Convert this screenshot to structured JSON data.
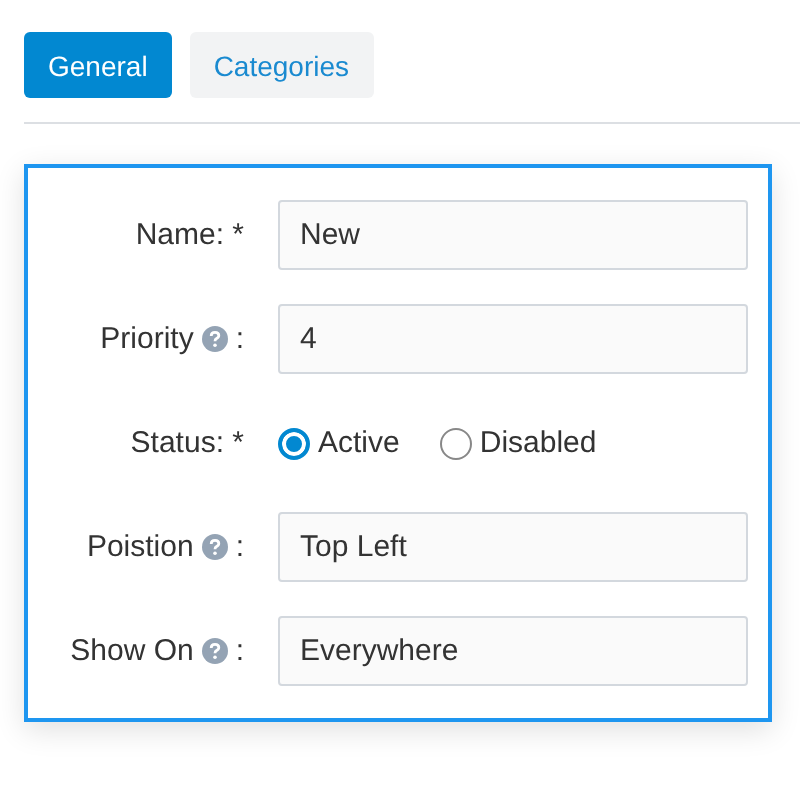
{
  "tabs": [
    {
      "label": "General",
      "selected": true
    },
    {
      "label": "Categories",
      "selected": false
    }
  ],
  "form": {
    "fields": [
      {
        "kind": "text",
        "label": "Name: *",
        "help": false,
        "value": "New"
      },
      {
        "kind": "text",
        "label": "Priority",
        "help": true,
        "colon": ":",
        "value": "4"
      },
      {
        "kind": "radio",
        "label": "Status: *",
        "help": false,
        "options": [
          {
            "label": "Active",
            "selected": true
          },
          {
            "label": "Disabled",
            "selected": false
          }
        ]
      },
      {
        "kind": "text",
        "label": "Poistion",
        "help": true,
        "colon": ":",
        "value": "Top Left"
      },
      {
        "kind": "text",
        "label": "Show On",
        "help": true,
        "colon": ":",
        "value": "Everywhere"
      }
    ]
  }
}
